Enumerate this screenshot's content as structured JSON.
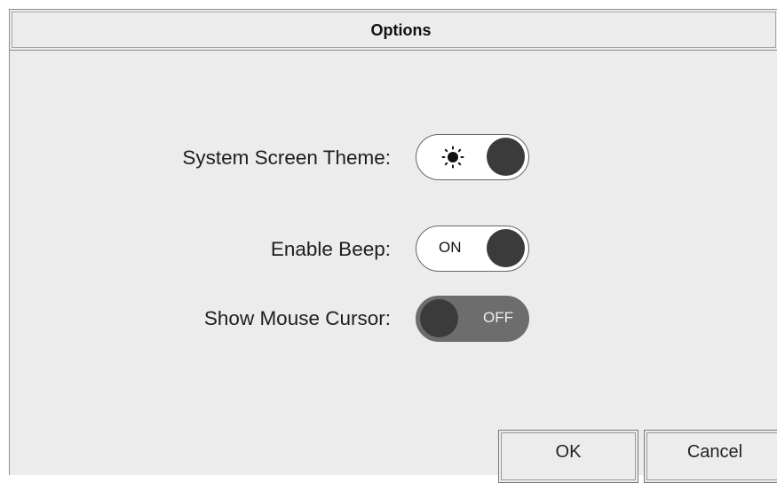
{
  "dialog": {
    "title": "Options"
  },
  "options": {
    "theme": {
      "label": "System Screen Theme:",
      "icon": "sun-icon",
      "state": "dark"
    },
    "beep": {
      "label": "Enable Beep:",
      "state_text": "ON"
    },
    "cursor": {
      "label": "Show Mouse Cursor:",
      "state_text": "OFF"
    }
  },
  "buttons": {
    "ok": "OK",
    "cancel": "Cancel"
  },
  "colors": {
    "background": "#ececec",
    "knob": "#3b3b3b",
    "toggle_off_track": "#6d6d6d"
  }
}
